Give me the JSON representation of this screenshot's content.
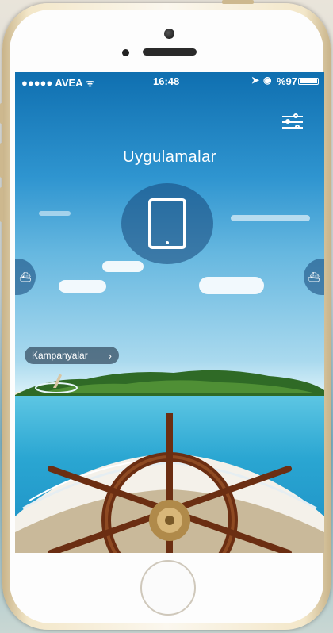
{
  "status_bar": {
    "carrier": "●●●●● AVEA ᯤ",
    "time": "16:48",
    "battery_pct": "%97"
  },
  "screen": {
    "title": "Uygulamalar",
    "campaign_button": "Kampanyalar"
  },
  "icons": {
    "filter": "filter-sliders-icon",
    "tablet": "tablet-icon",
    "left": "ship-icon",
    "right": "ship-icon"
  },
  "colors": {
    "sky_top": "#0f6fb0",
    "sea": "#2aa6d2",
    "wheel": "#6b2e12"
  }
}
